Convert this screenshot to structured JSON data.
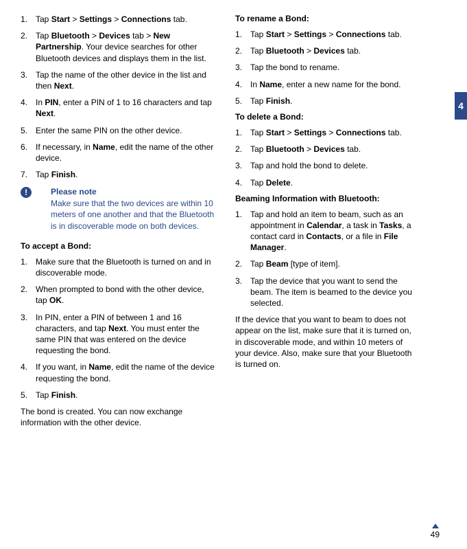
{
  "left": {
    "list1": [
      {
        "n": "1.",
        "html": "Tap <b>Start</b> > <b>Settings</b> > <b>Connections</b> tab."
      },
      {
        "n": "2.",
        "html": "Tap <b>Bluetooth</b> > <b>Devices</b> tab > <b>New Partnership</b>. Your device searches for other Bluetooth devices and displays them in the list."
      },
      {
        "n": "3.",
        "html": "Tap the name of the other device in the list and then <b>Next</b>."
      },
      {
        "n": "4.",
        "html": "In <b>PIN</b>, enter a PIN of 1 to 16 characters and tap <b>Next</b>."
      },
      {
        "n": "5.",
        "html": "Enter the same PIN on the other device."
      },
      {
        "n": "6.",
        "html": "If necessary, in <b>Name</b>, edit the name of the other device."
      },
      {
        "n": "7.",
        "html": "Tap <b>Finish</b>."
      }
    ],
    "note": {
      "title": "Please note",
      "body": "Make sure that the two devices are within 10 meters of one another and that the Bluetooth is in discoverable mode on both devices."
    },
    "accept_heading": "To accept a Bond:",
    "list2": [
      {
        "n": "1.",
        "html": "Make sure that the Bluetooth is turned on and in discoverable mode."
      },
      {
        "n": "2.",
        "html": "When prompted to bond with the other device, tap <b>OK</b>."
      },
      {
        "n": "3.",
        "html": "In PIN, enter a PIN of between 1 and 16 characters, and tap <b>Next</b>. You must enter the same PIN that was entered on the device requesting the bond."
      },
      {
        "n": "4.",
        "html": "If you want, in <b>Name</b>, edit the name of the device requesting the bond."
      },
      {
        "n": "5.",
        "html": "Tap <b>Finish</b>."
      }
    ],
    "para": "The bond is created. You can now exchange information with the other device."
  },
  "right": {
    "rename_heading": "To rename a Bond:",
    "rename_list": [
      {
        "n": "1.",
        "html": "Tap <b>Start</b> > <b>Settings</b> > <b>Connections</b> tab."
      },
      {
        "n": "2.",
        "html": "Tap <b>Bluetooth</b> > <b>Devices</b> tab."
      },
      {
        "n": "3.",
        "html": "Tap the bond to rename."
      },
      {
        "n": "4.",
        "html": "In <b>Name</b>, enter a new name for the bond."
      },
      {
        "n": "5.",
        "html": "Tap <b>Finish</b>."
      }
    ],
    "delete_heading": "To delete a Bond:",
    "delete_list": [
      {
        "n": "1.",
        "html": "Tap <b>Start</b> > <b>Settings</b> > <b>Connections</b> tab."
      },
      {
        "n": "2.",
        "html": "Tap <b>Bluetooth</b> > <b>Devices</b> tab."
      },
      {
        "n": "3.",
        "html": "Tap and hold the bond to delete."
      },
      {
        "n": "4.",
        "html": "Tap <b>Delete</b>."
      }
    ],
    "beam_heading": "Beaming Information with Bluetooth:",
    "beam_list": [
      {
        "n": "1.",
        "html": "Tap and hold an item to beam, such as an appointment in <b>Calendar</b>, a task in <b>Tasks</b>, a contact card in <b>Contacts</b>, or a file in <b>File Manager</b>."
      },
      {
        "n": "2.",
        "html": "Tap <b>Beam</b> [type of item]."
      },
      {
        "n": "3.",
        "html": "Tap the device that you want to send the beam. The item is beamed to the device you selected."
      }
    ],
    "para": "If the device that you want to beam to does not appear on the list, make sure that it is turned on, in discoverable mode, and within 10 meters of your device. Also, make sure that your Bluetooth is turned on."
  },
  "chapter_tab": "4",
  "page_number": "49"
}
